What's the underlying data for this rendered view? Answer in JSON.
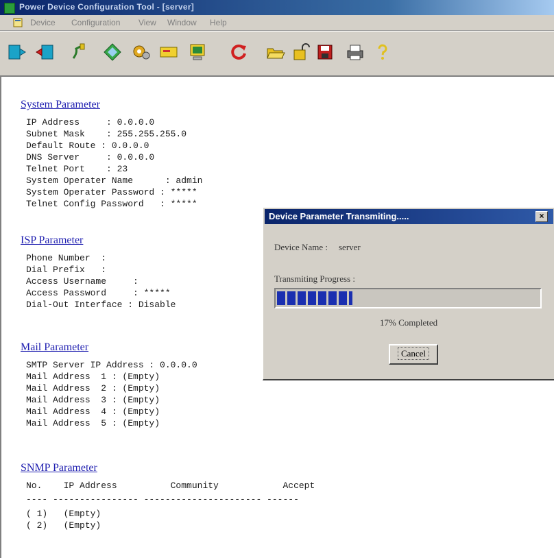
{
  "window": {
    "title": "Power Device Configuration Tool - [server]"
  },
  "menu": [
    "Device",
    "Configuration",
    "View",
    "Window",
    "Help"
  ],
  "toolbar": {
    "icons": [
      "connect-icon",
      "disconnect-icon",
      "plug-icon",
      "diamond-arrows-icon",
      "gears-icon",
      "card-icon",
      "monitor-icon",
      "refresh-icon",
      "open-folder-icon",
      "unlock-icon",
      "save-disk-icon",
      "print-icon",
      "help-icon"
    ]
  },
  "system": {
    "heading": "System Parameter",
    "lines": [
      "IP Address     : 0.0.0.0",
      "Subnet Mask    : 255.255.255.0",
      "Default Route : 0.0.0.0",
      "DNS Server     : 0.0.0.0",
      "Telnet Port    : 23",
      "System Operater Name      : admin",
      "System Operater Password : *****",
      "Telnet Config Password   : *****"
    ]
  },
  "isp": {
    "heading": "ISP Parameter",
    "lines": [
      "Phone Number  :",
      "Dial Prefix   :",
      "Access Username     :",
      "Access Password     : *****",
      "Dial-Out Interface : Disable"
    ]
  },
  "mail": {
    "heading": "Mail Parameter",
    "lines": [
      "SMTP Server IP Address : 0.0.0.0",
      "Mail Address  1 : (Empty)",
      "Mail Address  2 : (Empty)",
      "Mail Address  3 : (Empty)",
      "Mail Address  4 : (Empty)",
      "Mail Address  5 : (Empty)"
    ]
  },
  "snmp": {
    "heading": "SNMP Parameter",
    "header_line": "No.    IP Address          Community            Accept",
    "rule_line": "---- ---------------- ---------------------- ------",
    "rows": [
      "( 1)   (Empty)",
      "( 2)   (Empty)"
    ]
  },
  "dialog": {
    "title": "Device Parameter Transmiting.....",
    "close": "×",
    "device_label": "Device Name :",
    "device_value": "server",
    "progress_label": "Transmiting Progress :",
    "progress_value": 0.17,
    "completed_text": "17% Completed",
    "cancel_label": "Cancel"
  },
  "colors": {
    "link": "#1f1fb0",
    "progress": "#1a2fb0",
    "titlebar": "#0a246a"
  }
}
